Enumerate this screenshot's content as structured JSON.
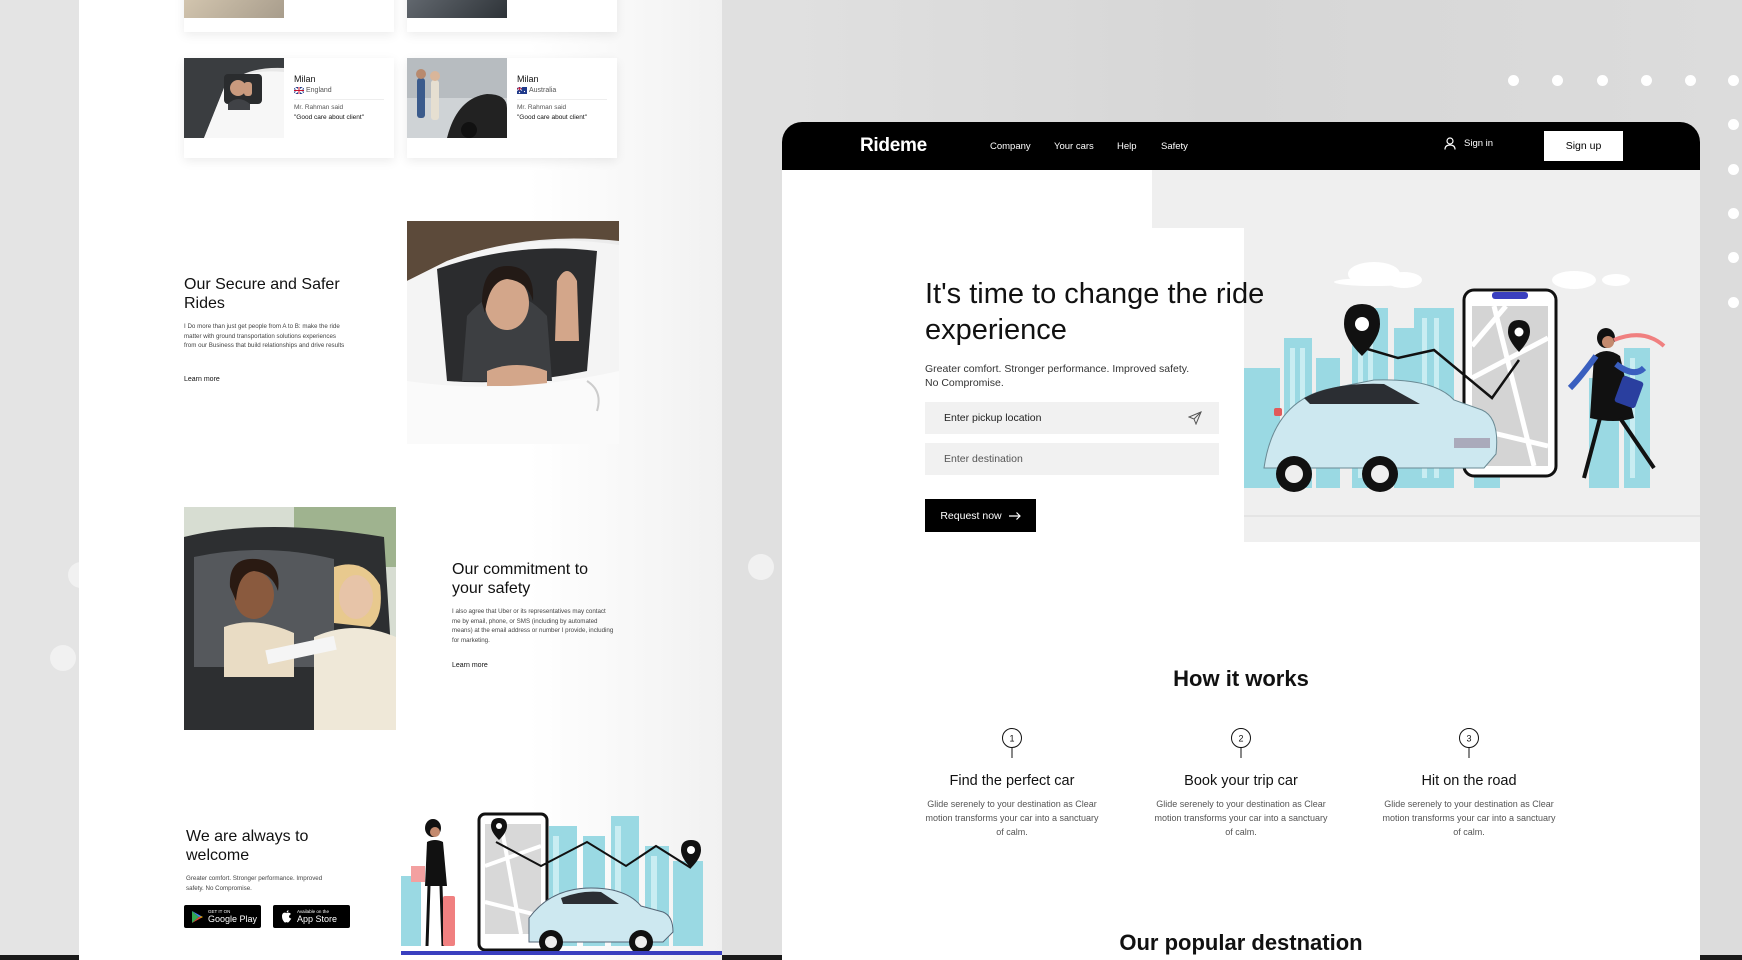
{
  "reviews": {
    "items": [
      {
        "name": "Milan",
        "country": "England",
        "author": "Mr. Rahman said",
        "quote": "\"Good care about client\""
      },
      {
        "name": "Milan",
        "country": "Australia",
        "author": "Mr. Rahman said",
        "quote": "\"Good care about client\""
      }
    ]
  },
  "secure": {
    "title": "Our Secure and Safer Rides",
    "body": "I Do more than just get people from A to B: make the ride matter with ground transportation solutions experiences from our Business that build relationships and drive results",
    "link": "Learn more"
  },
  "commitment": {
    "title": "Our commitment to your safety",
    "body": "I also agree that Uber or its representatives may contact me by email, phone, or SMS (including by automated means) at the email address or number I provide, including for marketing.",
    "link": "Learn more"
  },
  "welcome": {
    "title": "We are always to welcome",
    "body": "Greater comfort. Stronger performance. Improved safety. No Compromise.",
    "google_small": "GET IT ON",
    "google_big": "Google Play",
    "apple_small": "Available on the",
    "apple_big": "App Store"
  },
  "nav": {
    "brand": "Rideme",
    "links": [
      "Company",
      "Your cars",
      "Help",
      "Safety"
    ],
    "signin": "Sign in",
    "signup": "Sign up"
  },
  "hero": {
    "title": "It's time to change the ride experience",
    "subtitle_line1": "Greater comfort. Stronger performance. Improved safety.",
    "subtitle_line2": "No Compromise.",
    "pickup_placeholder": "Enter pickup location",
    "destination_placeholder": "Enter destination",
    "request_label": "Request now"
  },
  "how": {
    "title": "How it works",
    "steps": [
      {
        "num": "1",
        "title": "Find the perfect car",
        "desc": "Glide serenely to your destination as Clear motion transforms your car into a sanctuary of calm."
      },
      {
        "num": "2",
        "title": "Book your trip car",
        "desc": "Glide serenely to your destination as Clear motion transforms your car into a sanctuary of calm."
      },
      {
        "num": "3",
        "title": "Hit on the road",
        "desc": "Glide serenely to your destination as Clear motion transforms your car into a sanctuary of calm."
      }
    ]
  },
  "popular": {
    "title": "Our popular destnation"
  },
  "colors": {
    "brand_black": "#000000",
    "illustration_blue": "#9ad9e3",
    "car_blue": "#cde8f0",
    "panel_gray": "#efefef"
  },
  "icons": [
    "user-icon",
    "send-arrow-icon",
    "arrow-right-icon",
    "map-pin-icon",
    "google-play-icon",
    "apple-icon"
  ]
}
